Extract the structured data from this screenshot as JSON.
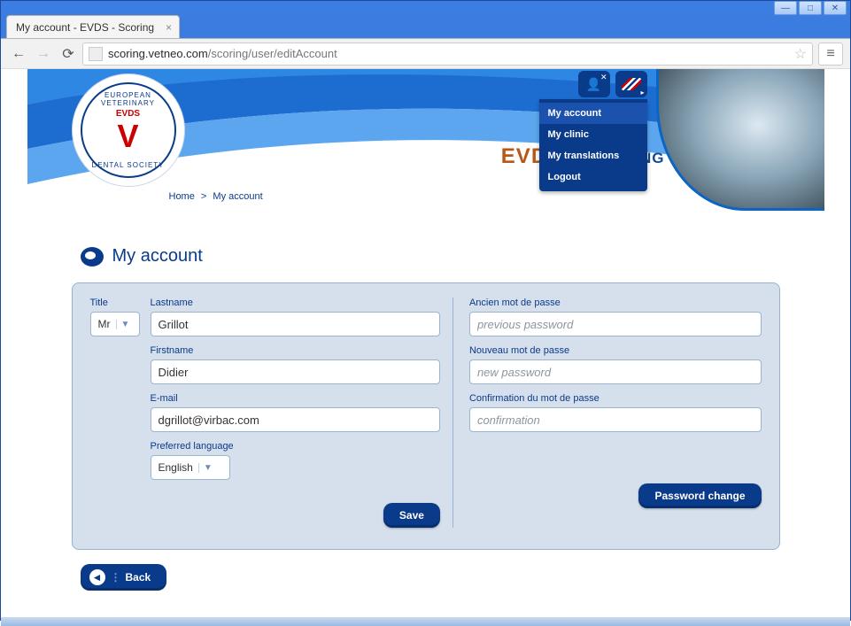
{
  "window": {
    "tab_title": "My account - EVDS - Scoring"
  },
  "url": {
    "host": "scoring.vetneo.com",
    "path": "/scoring/user/editAccount"
  },
  "header": {
    "title_part1": "EVDS",
    "title_sep": " - ",
    "title_part2": "Scoring",
    "logo_text_top": "EUROPEAN VETERINARY",
    "logo_text_mid": "EVDS",
    "logo_text_bot": "DENTAL SOCIETY"
  },
  "user_menu": {
    "items": [
      {
        "label": "My account",
        "active": true
      },
      {
        "label": "My clinic"
      },
      {
        "label": "My translations"
      },
      {
        "label": "Logout"
      }
    ]
  },
  "breadcrumb": {
    "home": "Home",
    "sep": ">",
    "current": "My account"
  },
  "section_title": "My account",
  "form": {
    "title_label": "Title",
    "title_value": "Mr",
    "lastname_label": "Lastname",
    "lastname_value": "Grillot",
    "firstname_label": "Firstname",
    "firstname_value": "Didier",
    "email_label": "E-mail",
    "email_value": "dgrillot@virbac.com",
    "lang_label": "Preferred language",
    "lang_value": "English",
    "save_label": "Save"
  },
  "password": {
    "old_label": "Ancien mot de passe",
    "old_placeholder": "previous password",
    "new_label": "Nouveau mot de passe",
    "new_placeholder": "new password",
    "confirm_label": "Confirmation du mot de passe",
    "confirm_placeholder": "confirmation",
    "button_label": "Password change"
  },
  "back_label": "Back"
}
